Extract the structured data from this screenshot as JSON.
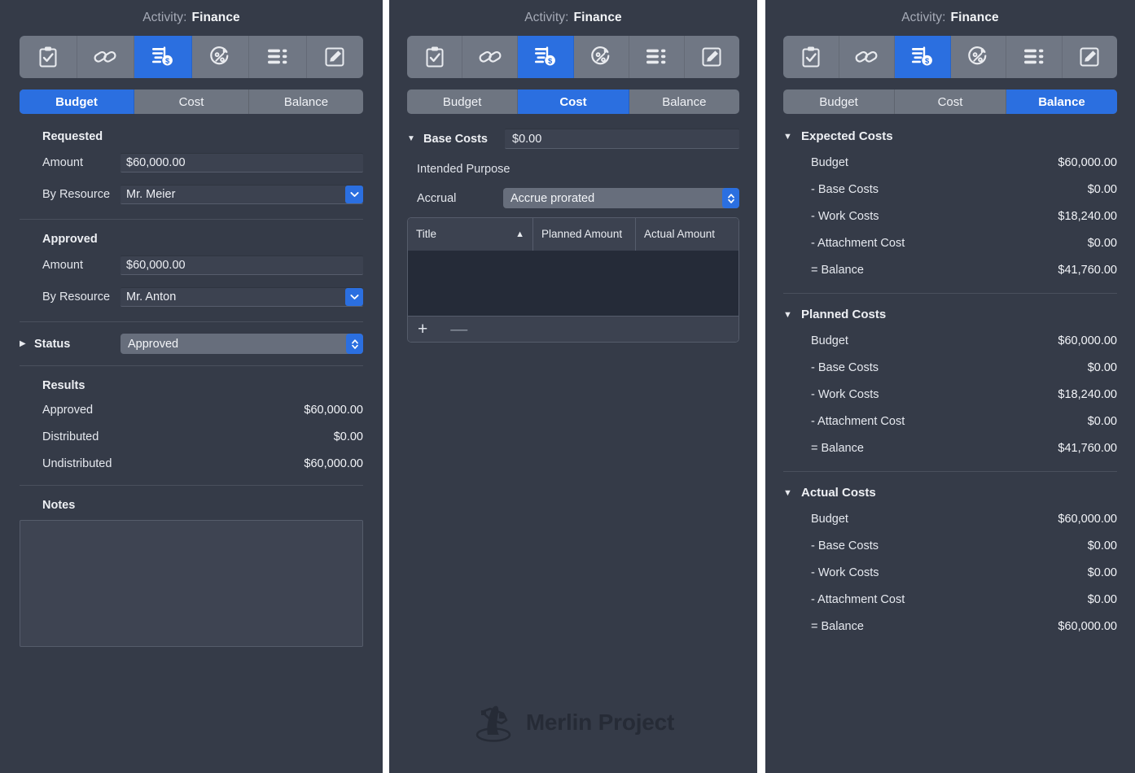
{
  "window": {
    "title_label": "Activity:",
    "title_value": "Finance"
  },
  "toolbar": {
    "icons": [
      {
        "name": "clipboard-check-icon",
        "label": "Info"
      },
      {
        "name": "link-icon",
        "label": "Dependencies"
      },
      {
        "name": "money-lines-icon",
        "label": "Finance"
      },
      {
        "name": "percent-refresh-icon",
        "label": "Progress"
      },
      {
        "name": "list-bars-icon",
        "label": "Resources"
      },
      {
        "name": "pencil-square-icon",
        "label": "Notes"
      }
    ],
    "active_index": 2,
    "active_color": "#2b6fe0"
  },
  "tabs": {
    "items": [
      "Budget",
      "Cost",
      "Balance"
    ],
    "panel1_active": "Budget",
    "panel2_active": "Cost",
    "panel3_active": "Balance"
  },
  "panel_budget": {
    "requested": {
      "heading": "Requested",
      "amount_label": "Amount",
      "amount_value": "$60,000.00",
      "by_resource_label": "By Resource",
      "by_resource_value": "Mr. Meier"
    },
    "approved": {
      "heading": "Approved",
      "amount_label": "Amount",
      "amount_value": "$60,000.00",
      "by_resource_label": "By Resource",
      "by_resource_value": "Mr. Anton"
    },
    "status": {
      "label": "Status",
      "value": "Approved"
    },
    "results": {
      "heading": "Results",
      "rows": [
        {
          "label": "Approved",
          "value": "$60,000.00"
        },
        {
          "label": "Distributed",
          "value": "$0.00"
        },
        {
          "label": "Undistributed",
          "value": "$60,000.00"
        }
      ]
    },
    "notes": {
      "heading": "Notes",
      "value": ""
    }
  },
  "panel_cost": {
    "base_costs": {
      "label": "Base Costs",
      "value": "$0.00"
    },
    "intended_purpose_label": "Intended Purpose",
    "accrual": {
      "label": "Accrual",
      "value": "Accrue prorated"
    },
    "table": {
      "columns": [
        "Title",
        "Planned Amount",
        "Actual Amount"
      ],
      "sort_column": "Title",
      "sort_direction": "ascending",
      "rows": [],
      "add_button": "+",
      "remove_button": "—"
    },
    "branding": {
      "name": "Merlin Project"
    }
  },
  "panel_balance": {
    "groups": [
      {
        "heading": "Expected Costs",
        "rows": [
          {
            "label": "Budget",
            "value": "$60,000.00"
          },
          {
            "label": "- Base Costs",
            "value": "$0.00"
          },
          {
            "label": "- Work Costs",
            "value": "$18,240.00"
          },
          {
            "label": "- Attachment Cost",
            "value": "$0.00"
          },
          {
            "label": "= Balance",
            "value": "$41,760.00"
          }
        ]
      },
      {
        "heading": "Planned Costs",
        "rows": [
          {
            "label": "Budget",
            "value": "$60,000.00"
          },
          {
            "label": "- Base Costs",
            "value": "$0.00"
          },
          {
            "label": "- Work Costs",
            "value": "$18,240.00"
          },
          {
            "label": "- Attachment Cost",
            "value": "$0.00"
          },
          {
            "label": "= Balance",
            "value": "$41,760.00"
          }
        ]
      },
      {
        "heading": "Actual Costs",
        "rows": [
          {
            "label": "Budget",
            "value": "$60,000.00"
          },
          {
            "label": "- Base Costs",
            "value": "$0.00"
          },
          {
            "label": "- Work Costs",
            "value": "$0.00"
          },
          {
            "label": "- Attachment Cost",
            "value": "$0.00"
          },
          {
            "label": "= Balance",
            "value": "$60,000.00"
          }
        ]
      }
    ]
  },
  "colors": {
    "panel_bg": "#353b48",
    "accent": "#2b6fe0",
    "toolbar_bg": "#707784",
    "field_bg": "#3c4250",
    "table_body_bg": "#252b38"
  }
}
